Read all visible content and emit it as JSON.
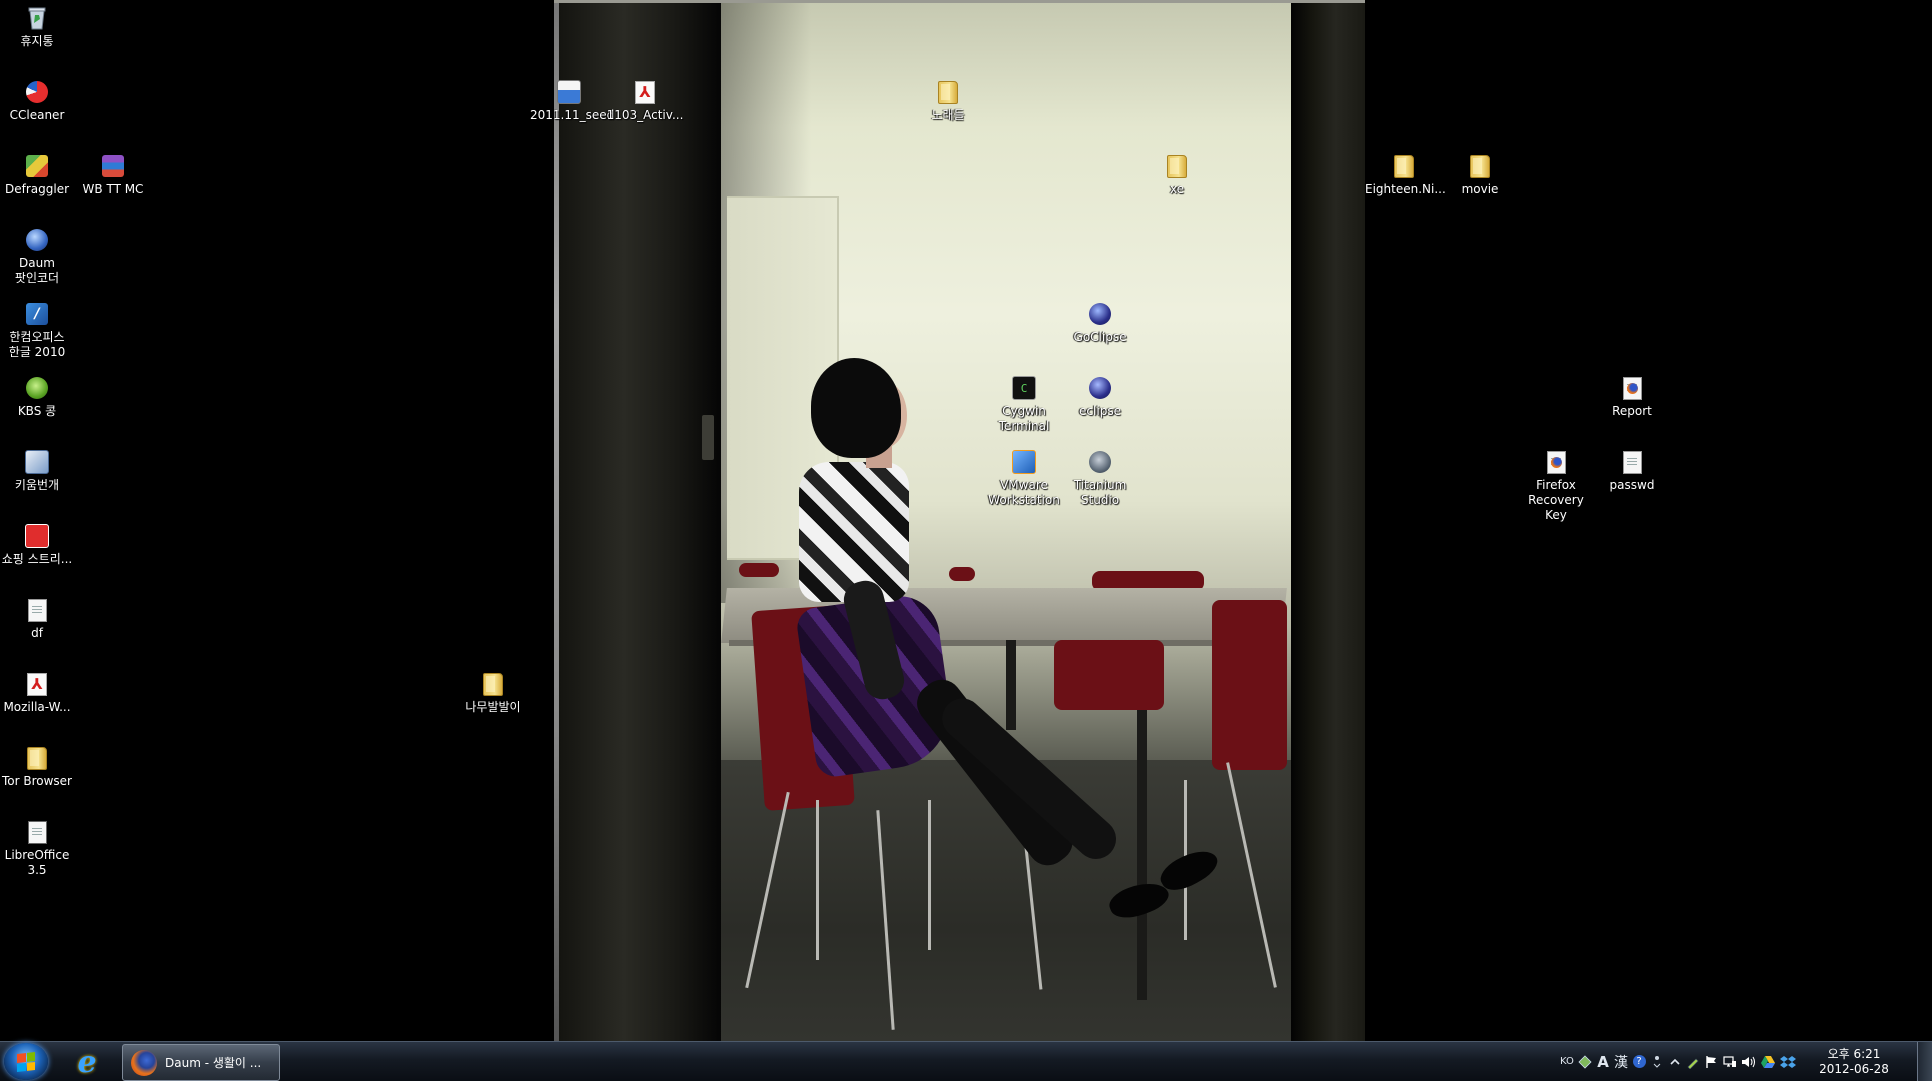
{
  "desktop": {
    "icons": [
      {
        "label": "휴지통",
        "icon": "recycle-bin-icon"
      },
      {
        "label": "CCleaner",
        "icon": "ccleaner-icon"
      },
      {
        "label": "Defraggler",
        "icon": "defraggler-icon"
      },
      {
        "label": "WB TT MC",
        "icon": "rar-archive-icon"
      },
      {
        "label": "Daum 팟인코더",
        "icon": "daum-potencoder-icon"
      },
      {
        "label": "한컴오피스 한글 2010",
        "icon": "hancom-office-icon"
      },
      {
        "label": "KBS 콩",
        "icon": "kbs-kong-icon"
      },
      {
        "label": "키움번개",
        "icon": "kiwoom-icon"
      },
      {
        "label": "쇼핑 스트리...",
        "icon": "shopping-icon"
      },
      {
        "label": "df",
        "icon": "document-icon"
      },
      {
        "label": "Mozilla-W...",
        "icon": "pdf-icon"
      },
      {
        "label": "Tor Browser",
        "icon": "folder-icon"
      },
      {
        "label": "LibreOffice 3.5",
        "icon": "libreoffice-icon"
      },
      {
        "label": "나무발발이",
        "icon": "folder-icon"
      },
      {
        "label": "2011.11_seed",
        "icon": "zip-archive-icon"
      },
      {
        "label": "1103_Activ...",
        "icon": "pdf-icon"
      },
      {
        "label": "노래들",
        "icon": "folder-icon"
      },
      {
        "label": "xe",
        "icon": "folder-icon"
      },
      {
        "label": "GoClipse",
        "icon": "goclipse-icon"
      },
      {
        "label": "Cygwin Terminal",
        "icon": "cygwin-terminal-icon"
      },
      {
        "label": "eclipse",
        "icon": "eclipse-icon"
      },
      {
        "label": "VMware Workstation",
        "icon": "vmware-icon"
      },
      {
        "label": "Titanium Studio",
        "icon": "titanium-studio-icon"
      },
      {
        "label": "Eighteen.Ni...",
        "icon": "folder-icon"
      },
      {
        "label": "movie",
        "icon": "folder-icon"
      },
      {
        "label": "Report",
        "icon": "firefox-document-icon"
      },
      {
        "label": "Firefox Recovery Key",
        "icon": "firefox-document-icon"
      },
      {
        "label": "passwd",
        "icon": "document-icon"
      }
    ]
  },
  "taskbar": {
    "start_icon": "windows-start-icon",
    "pinned_icon": "internet-explorer-icon",
    "pinned_glyph": "e",
    "active_window_label": "Daum - 생활이 ...",
    "tray": {
      "language": "KO",
      "ime_mode": "A",
      "hanja": "漢",
      "help": "?"
    },
    "clock_time": "오후 6:21",
    "clock_date": "2012-06-28"
  }
}
